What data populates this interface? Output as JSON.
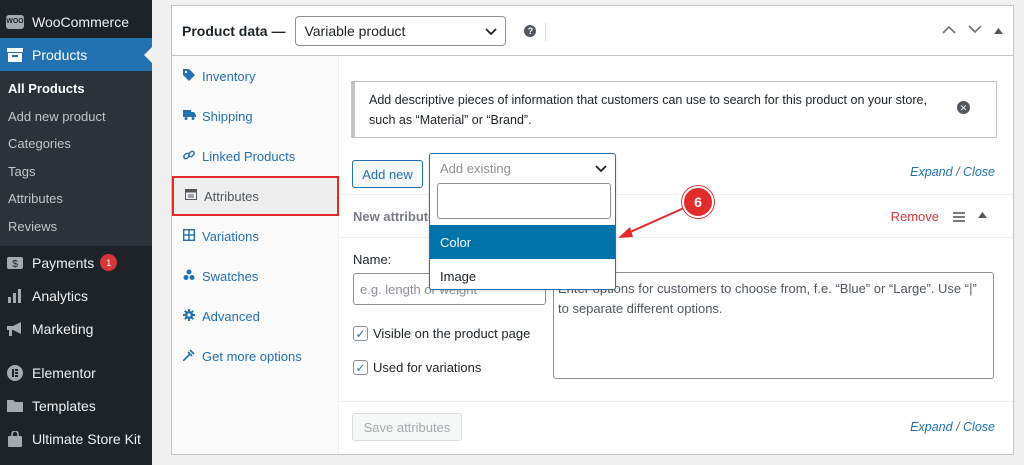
{
  "sidebar": {
    "items": [
      {
        "label": "WooCommerce"
      },
      {
        "label": "Products"
      }
    ],
    "submenu": [
      "All Products",
      "Add new product",
      "Categories",
      "Tags",
      "Attributes",
      "Reviews"
    ],
    "bottom_items": [
      {
        "label": "Payments",
        "badge": "1"
      },
      {
        "label": "Analytics"
      },
      {
        "label": "Marketing"
      },
      {
        "label": "Elementor"
      },
      {
        "label": "Templates"
      },
      {
        "label": "Ultimate Store Kit"
      }
    ],
    "woo_icon_text": "WOO"
  },
  "panel": {
    "title": "Product data —",
    "product_type": "Variable product",
    "help": "?",
    "tabs": [
      {
        "label": "Inventory",
        "icon": "tag-icon"
      },
      {
        "label": "Shipping",
        "icon": "truck-icon"
      },
      {
        "label": "Linked Products",
        "icon": "link-icon"
      },
      {
        "label": "Attributes",
        "icon": "table-icon"
      },
      {
        "label": "Variations",
        "icon": "grid-icon"
      },
      {
        "label": "Swatches",
        "icon": "circles-icon"
      },
      {
        "label": "Advanced",
        "icon": "gear-icon"
      },
      {
        "label": "Get more options",
        "icon": "plugin-icon"
      }
    ]
  },
  "attributes": {
    "notice": "Add descriptive pieces of information that customers can use to search for this product on your store, such as “Material” or “Brand”.",
    "add_new": "Add new",
    "add_existing_placeholder": "Add existing",
    "expand": "Expand",
    "separator": "/",
    "close": "Close",
    "row_name": "New attribute",
    "remove": "Remove",
    "name_label": "Name:",
    "name_placeholder": "e.g. length or weight",
    "values_text": "Enter options for customers to choose from, f.e. “Blue” or “Large”. Use “|” to separate different options.",
    "visible_label": "Visible on the product page",
    "variations_label": "Used for variations",
    "save": "Save attributes"
  },
  "dropdown": {
    "options": [
      "Color",
      "Image"
    ],
    "highlighted": "Color"
  },
  "annotation": {
    "step": "6",
    "color": "#e22c2c"
  },
  "colors": {
    "accent": "#2271b1",
    "sidebar_bg": "#1d2327",
    "highlight": "#0073aa"
  }
}
